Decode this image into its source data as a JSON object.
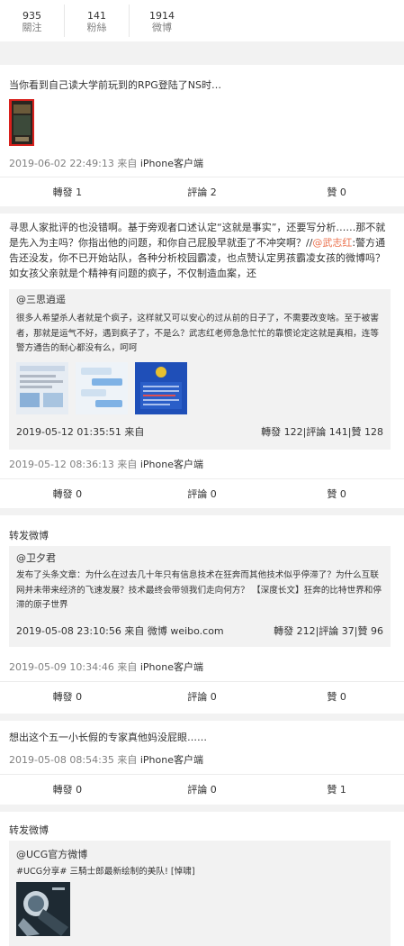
{
  "stats": [
    {
      "num": "935",
      "label": "關注"
    },
    {
      "num": "141",
      "label": "粉絲"
    },
    {
      "num": "1914",
      "label": "微博"
    }
  ],
  "posts": [
    {
      "text": "当你看到自己读大学前玩到的RPG登陆了NS时…",
      "meta": "2019-06-02 22:49:13 来自",
      "source": "iPhone客户端",
      "repost": "轉發 1",
      "comment": "評論 2",
      "like": "贊 0"
    },
    {
      "text_a": "寻思人家批评的也没错啊。基于旁观者口述认定“这就是事实”，还要写分析……那不就是先入为主吗？你指出他的问题，和你自己屁股早就歪了不冲突啊？//",
      "mention": "@武志红",
      "text_b": ":警方通告还没发，你不已开始站队，各种分析校园霸凌，也点赞认定男孩霸凌女孩的微博吗？如女孩父亲就是个精神有问题的疯子，不仅制造血案，还",
      "rt_user": "@三思逍遥",
      "rt_text": "很多人希望杀人者就是个疯子，这样就又可以安心的过从前的日子了，不需要改变啥。至于被害者，那就是运气不好，遇到疯子了，不是么？武志红老师急急忙忙的靠惯论定这就是真相，连等警方通告的耐心都没有么，呵呵",
      "rt_meta_left": "2019-05-12 01:35:51  来自",
      "rt_meta_right": "轉發 122|評論 141|贊 128",
      "meta": "2019-05-12 08:36:13 来自",
      "source": "iPhone客户端",
      "repost": "轉發 0",
      "comment": "評論 0",
      "like": "贊 0"
    },
    {
      "text": "转发微博",
      "rt_user": "@卫夕君",
      "rt_text": "发布了头条文章：为什么在过去几十年只有信息技术在狂奔而其他技术似乎停滞了？为什么互联网并未带来经济的飞速发展？技术最终会带领我们走向何方？ 【深度长文】狂奔的比特世界和停滞的原子世界",
      "rt_meta_left": "2019-05-08 23:10:56  来自  微博 weibo.com",
      "rt_meta_right": "轉發 212|評論 37|贊 96",
      "meta": "2019-05-09 10:34:46 来自",
      "source": "iPhone客户端",
      "repost": "轉發 0",
      "comment": "評論 0",
      "like": "贊 0"
    },
    {
      "text": "想出这个五一小长假的专家真他妈没屁眼……",
      "meta": "2019-05-08 08:54:35 来自",
      "source": "iPhone客户端",
      "repost": "轉發 0",
      "comment": "評論 0",
      "like": "贊 1"
    },
    {
      "text": "转发微博",
      "rt_user": "@UCG官方微博",
      "rt_text": "#UCG分享# 三騎士郎最新绘制的美队! [悼啸]"
    }
  ],
  "colors": {
    "mention": "#eb7350",
    "meta": "#808080",
    "bg": "#f2f2f2"
  }
}
